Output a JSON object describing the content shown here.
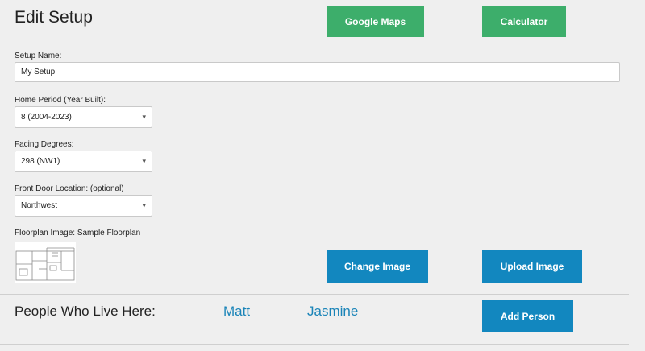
{
  "page": {
    "title": "Edit Setup"
  },
  "header_buttons": {
    "google_maps": "Google Maps",
    "calculator": "Calculator"
  },
  "form": {
    "setup_name": {
      "label": "Setup Name:",
      "value": "My Setup"
    },
    "home_period": {
      "label": "Home Period (Year Built):",
      "value": "8 (2004-2023)"
    },
    "facing_degrees": {
      "label": "Facing Degrees:",
      "value": "298 (NW1)"
    },
    "front_door": {
      "label": "Front Door Location: (optional)",
      "value": "Northwest"
    },
    "floorplan": {
      "label": "Floorplan Image: Sample Floorplan"
    }
  },
  "image_buttons": {
    "change": "Change Image",
    "upload": "Upload Image"
  },
  "people": {
    "heading": "People Who Live Here:",
    "names": [
      "Matt",
      "Jasmine"
    ],
    "add_label": "Add Person"
  },
  "colors": {
    "green": "#3dae6b",
    "blue": "#1287bf",
    "link": "#1a84b8"
  }
}
